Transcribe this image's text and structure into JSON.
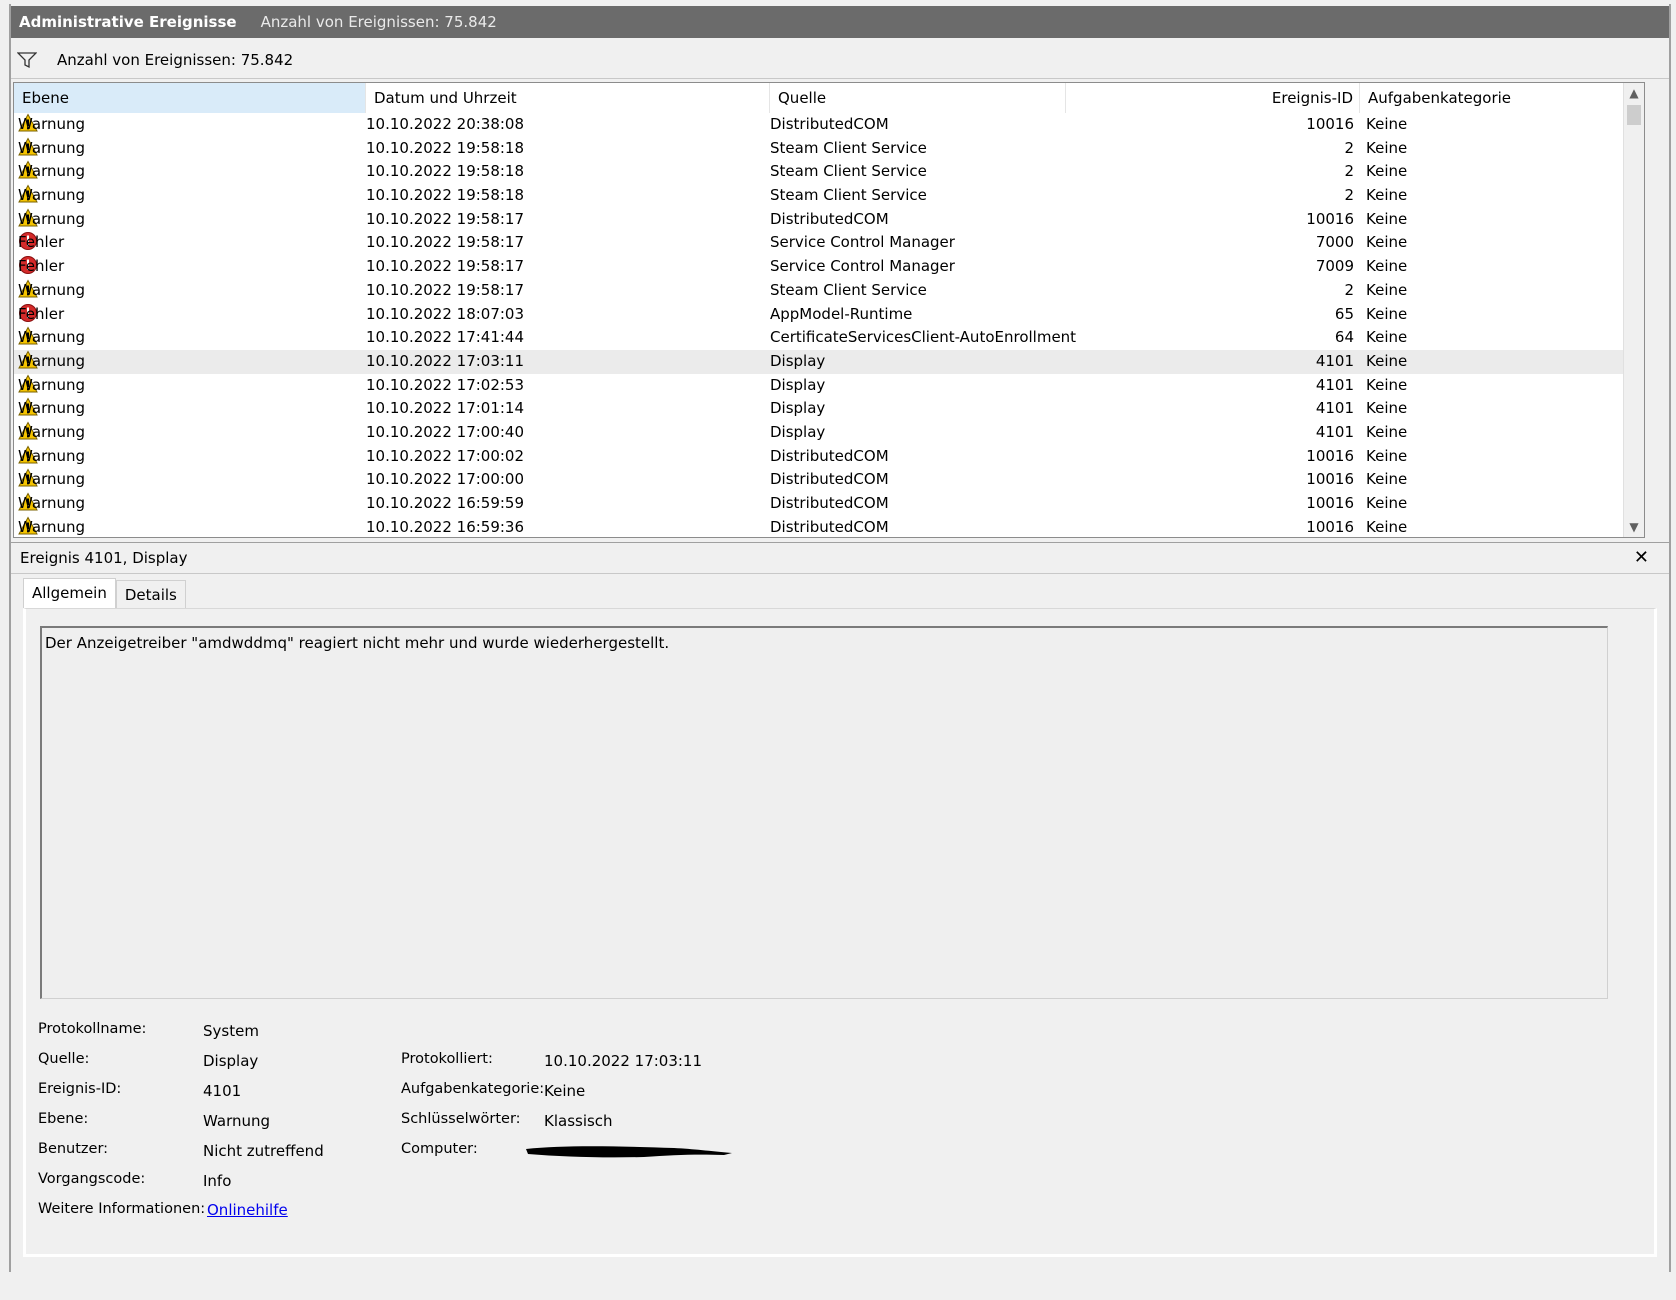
{
  "titlebar": {
    "title": "Administrative Ereignisse",
    "count": "Anzahl von Ereignissen: 75.842"
  },
  "filterbar": {
    "icon": "filter-icon",
    "count": "Anzahl von Ereignissen: 75.842"
  },
  "list": {
    "columns": {
      "level": "Ebene",
      "datetime": "Datum und Uhrzeit",
      "source": "Quelle",
      "event_id": "Ereignis-ID",
      "category": "Aufgabenkategorie"
    },
    "rows": [
      {
        "level": "Warnung",
        "icon": "warning-icon",
        "datetime": "10.10.2022 20:38:08",
        "source": "DistributedCOM",
        "event_id": "10016",
        "category": "Keine"
      },
      {
        "level": "Warnung",
        "icon": "warning-icon",
        "datetime": "10.10.2022 19:58:18",
        "source": "Steam Client Service",
        "event_id": "2",
        "category": "Keine"
      },
      {
        "level": "Warnung",
        "icon": "warning-icon",
        "datetime": "10.10.2022 19:58:18",
        "source": "Steam Client Service",
        "event_id": "2",
        "category": "Keine"
      },
      {
        "level": "Warnung",
        "icon": "warning-icon",
        "datetime": "10.10.2022 19:58:18",
        "source": "Steam Client Service",
        "event_id": "2",
        "category": "Keine"
      },
      {
        "level": "Warnung",
        "icon": "warning-icon",
        "datetime": "10.10.2022 19:58:17",
        "source": "DistributedCOM",
        "event_id": "10016",
        "category": "Keine"
      },
      {
        "level": "Fehler",
        "icon": "error-icon",
        "datetime": "10.10.2022 19:58:17",
        "source": "Service Control Manager",
        "event_id": "7000",
        "category": "Keine"
      },
      {
        "level": "Fehler",
        "icon": "error-icon",
        "datetime": "10.10.2022 19:58:17",
        "source": "Service Control Manager",
        "event_id": "7009",
        "category": "Keine"
      },
      {
        "level": "Warnung",
        "icon": "warning-icon",
        "datetime": "10.10.2022 19:58:17",
        "source": "Steam Client Service",
        "event_id": "2",
        "category": "Keine"
      },
      {
        "level": "Fehler",
        "icon": "error-icon",
        "datetime": "10.10.2022 18:07:03",
        "source": "AppModel-Runtime",
        "event_id": "65",
        "category": "Keine"
      },
      {
        "level": "Warnung",
        "icon": "warning-icon",
        "datetime": "10.10.2022 17:41:44",
        "source": "CertificateServicesClient-AutoEnrollment",
        "event_id": "64",
        "category": "Keine"
      },
      {
        "level": "Warnung",
        "icon": "warning-icon",
        "datetime": "10.10.2022 17:03:11",
        "source": "Display",
        "event_id": "4101",
        "category": "Keine"
      },
      {
        "level": "Warnung",
        "icon": "warning-icon",
        "datetime": "10.10.2022 17:02:53",
        "source": "Display",
        "event_id": "4101",
        "category": "Keine"
      },
      {
        "level": "Warnung",
        "icon": "warning-icon",
        "datetime": "10.10.2022 17:01:14",
        "source": "Display",
        "event_id": "4101",
        "category": "Keine"
      },
      {
        "level": "Warnung",
        "icon": "warning-icon",
        "datetime": "10.10.2022 17:00:40",
        "source": "Display",
        "event_id": "4101",
        "category": "Keine"
      },
      {
        "level": "Warnung",
        "icon": "warning-icon",
        "datetime": "10.10.2022 17:00:02",
        "source": "DistributedCOM",
        "event_id": "10016",
        "category": "Keine"
      },
      {
        "level": "Warnung",
        "icon": "warning-icon",
        "datetime": "10.10.2022 17:00:00",
        "source": "DistributedCOM",
        "event_id": "10016",
        "category": "Keine"
      },
      {
        "level": "Warnung",
        "icon": "warning-icon",
        "datetime": "10.10.2022 16:59:59",
        "source": "DistributedCOM",
        "event_id": "10016",
        "category": "Keine"
      },
      {
        "level": "Warnung",
        "icon": "warning-icon",
        "datetime": "10.10.2022 16:59:36",
        "source": "DistributedCOM",
        "event_id": "10016",
        "category": "Keine"
      }
    ]
  },
  "detail": {
    "title": "Ereignis 4101, Display",
    "close_icon": "close-icon",
    "tabs": {
      "general": "Allgemein",
      "details": "Details"
    },
    "message": "Der Anzeigetreiber \"amdwddmq\" reagiert nicht mehr und wurde wiederhergestellt.",
    "props": {
      "log_name_label": "Protokollname:",
      "log_name": "System",
      "source_label": "Quelle:",
      "source": "Display",
      "event_id_label": "Ereignis-ID:",
      "event_id": "4101",
      "level_label": "Ebene:",
      "level": "Warnung",
      "user_label": "Benutzer:",
      "user": "Nicht zutreffend",
      "opcode_label": "Vorgangscode:",
      "opcode": "Info",
      "more_info_label": "Weitere Informationen:",
      "more_info_link": "Onlinehilfe",
      "logged_label": "Protokolliert:",
      "logged": "10.10.2022 17:03:11",
      "task_category_label": "Aufgabenkategorie:",
      "task_category": "Keine",
      "keywords_label": "Schlüsselwörter:",
      "keywords": "Klassisch",
      "computer_label": "Computer:"
    }
  },
  "colors": {
    "titlebar": "#6b6b6b",
    "selected_header": "#d9ebf9",
    "link": "#0000ee",
    "warning": "#f5c400",
    "error": "#d42a2a"
  }
}
